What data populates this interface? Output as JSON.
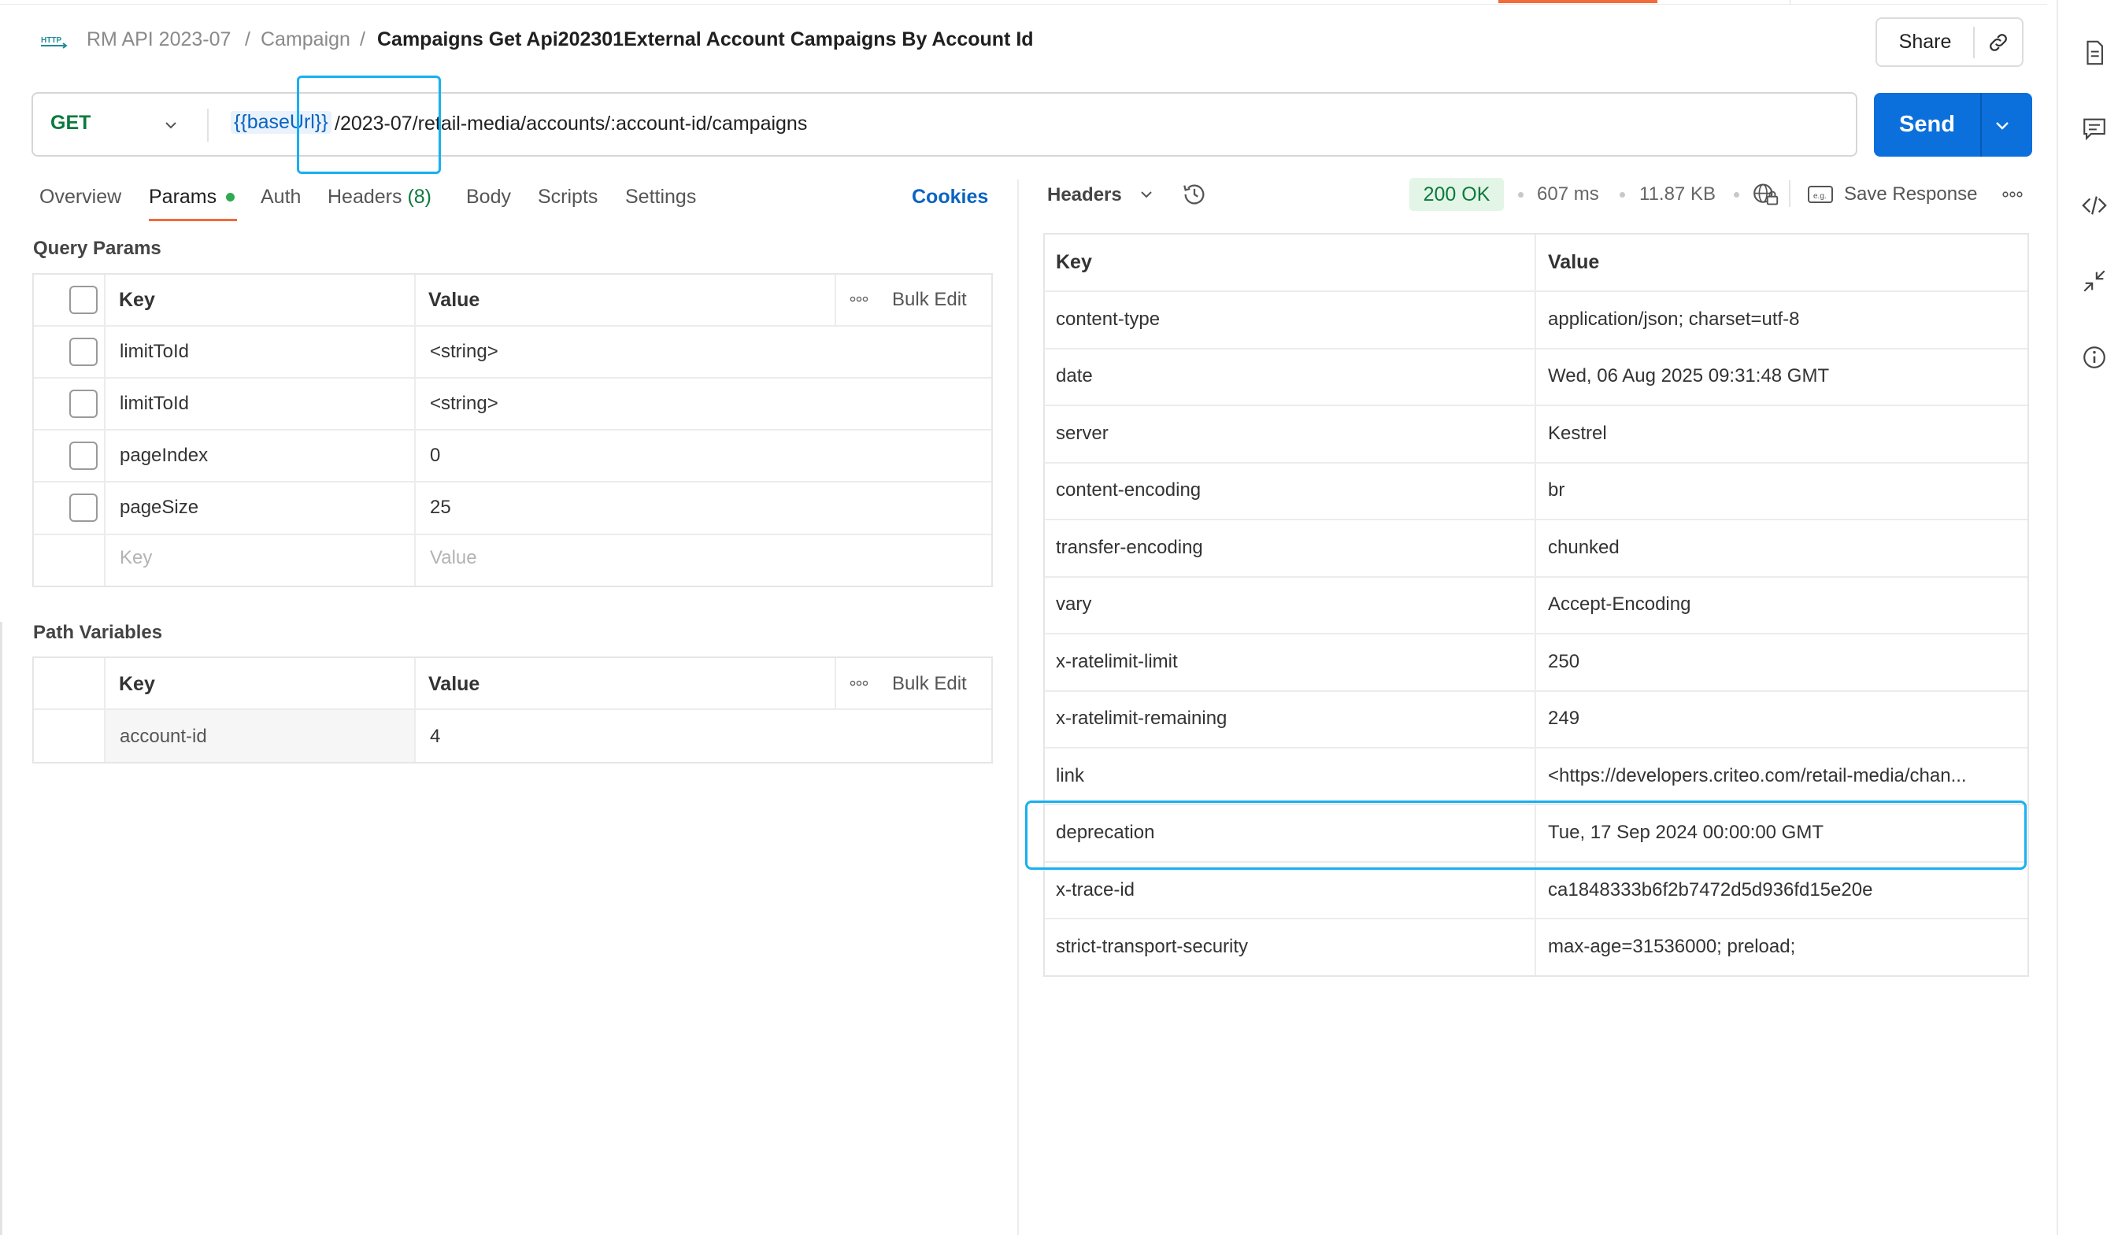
{
  "breadcrumb": {
    "icon": "http-icon",
    "items": [
      "RM API 2023-07",
      "Campaign"
    ],
    "separator": "/",
    "title": "Campaigns Get Api202301External Account Campaigns By Account Id"
  },
  "share": {
    "label": "Share",
    "link_icon": "link-icon"
  },
  "request": {
    "method": "GET",
    "url_variable": "{{baseUrl}}",
    "url_path": "/2023-07/retail-media/accounts/:account-id/campaigns",
    "send_label": "Send"
  },
  "tabs": [
    {
      "label": "Overview"
    },
    {
      "label": "Params",
      "active": true
    },
    {
      "label": "Auth"
    },
    {
      "label": "Headers",
      "count": "(8)"
    },
    {
      "label": "Body"
    },
    {
      "label": "Scripts"
    },
    {
      "label": "Settings"
    }
  ],
  "cookies_label": "Cookies",
  "query_params": {
    "title": "Query Params",
    "key_header": "Key",
    "value_header": "Value",
    "bulk_edit": "Bulk Edit",
    "rows": [
      {
        "key": "limitToId",
        "value": "<string>"
      },
      {
        "key": "limitToId",
        "value": "<string>"
      },
      {
        "key": "pageIndex",
        "value": "0"
      },
      {
        "key": "pageSize",
        "value": "25"
      }
    ],
    "placeholder_key": "Key",
    "placeholder_value": "Value"
  },
  "path_variables": {
    "title": "Path Variables",
    "key_header": "Key",
    "value_header": "Value",
    "bulk_edit": "Bulk Edit",
    "rows": [
      {
        "key": "account-id",
        "value": "4"
      }
    ]
  },
  "response": {
    "view_label": "Headers",
    "status": "200 OK",
    "time": "607 ms",
    "size": "11.87 KB",
    "save_label": "Save Response",
    "colors": {
      "status_bg": "#e3f5e7",
      "status_fg": "#0b7a3e"
    },
    "headers_table": {
      "key_header": "Key",
      "value_header": "Value",
      "rows": [
        {
          "key": "content-type",
          "value": "application/json; charset=utf-8"
        },
        {
          "key": "date",
          "value": "Wed, 06 Aug 2025 09:31:48 GMT"
        },
        {
          "key": "server",
          "value": "Kestrel"
        },
        {
          "key": "content-encoding",
          "value": "br"
        },
        {
          "key": "transfer-encoding",
          "value": "chunked"
        },
        {
          "key": "vary",
          "value": "Accept-Encoding"
        },
        {
          "key": "x-ratelimit-limit",
          "value": "250"
        },
        {
          "key": "x-ratelimit-remaining",
          "value": "249"
        },
        {
          "key": "link",
          "value": "<https://developers.criteo.com/retail-media/chan..."
        },
        {
          "key": "deprecation",
          "value": "Tue, 17 Sep 2024 00:00:00 GMT"
        },
        {
          "key": "x-trace-id",
          "value": "ca1848333b6f2b7472d5d936fd15e20e"
        },
        {
          "key": "strict-transport-security",
          "value": "max-age=31536000; preload;"
        }
      ]
    }
  },
  "right_rail_icons": [
    "document-icon",
    "comment-icon",
    "code-icon",
    "collapse-icon",
    "info-icon"
  ],
  "accent_colors": {
    "brand_orange": "#f26b3a",
    "primary_blue": "#0b6fdc",
    "highlight_cyan": "#18b0f0"
  }
}
